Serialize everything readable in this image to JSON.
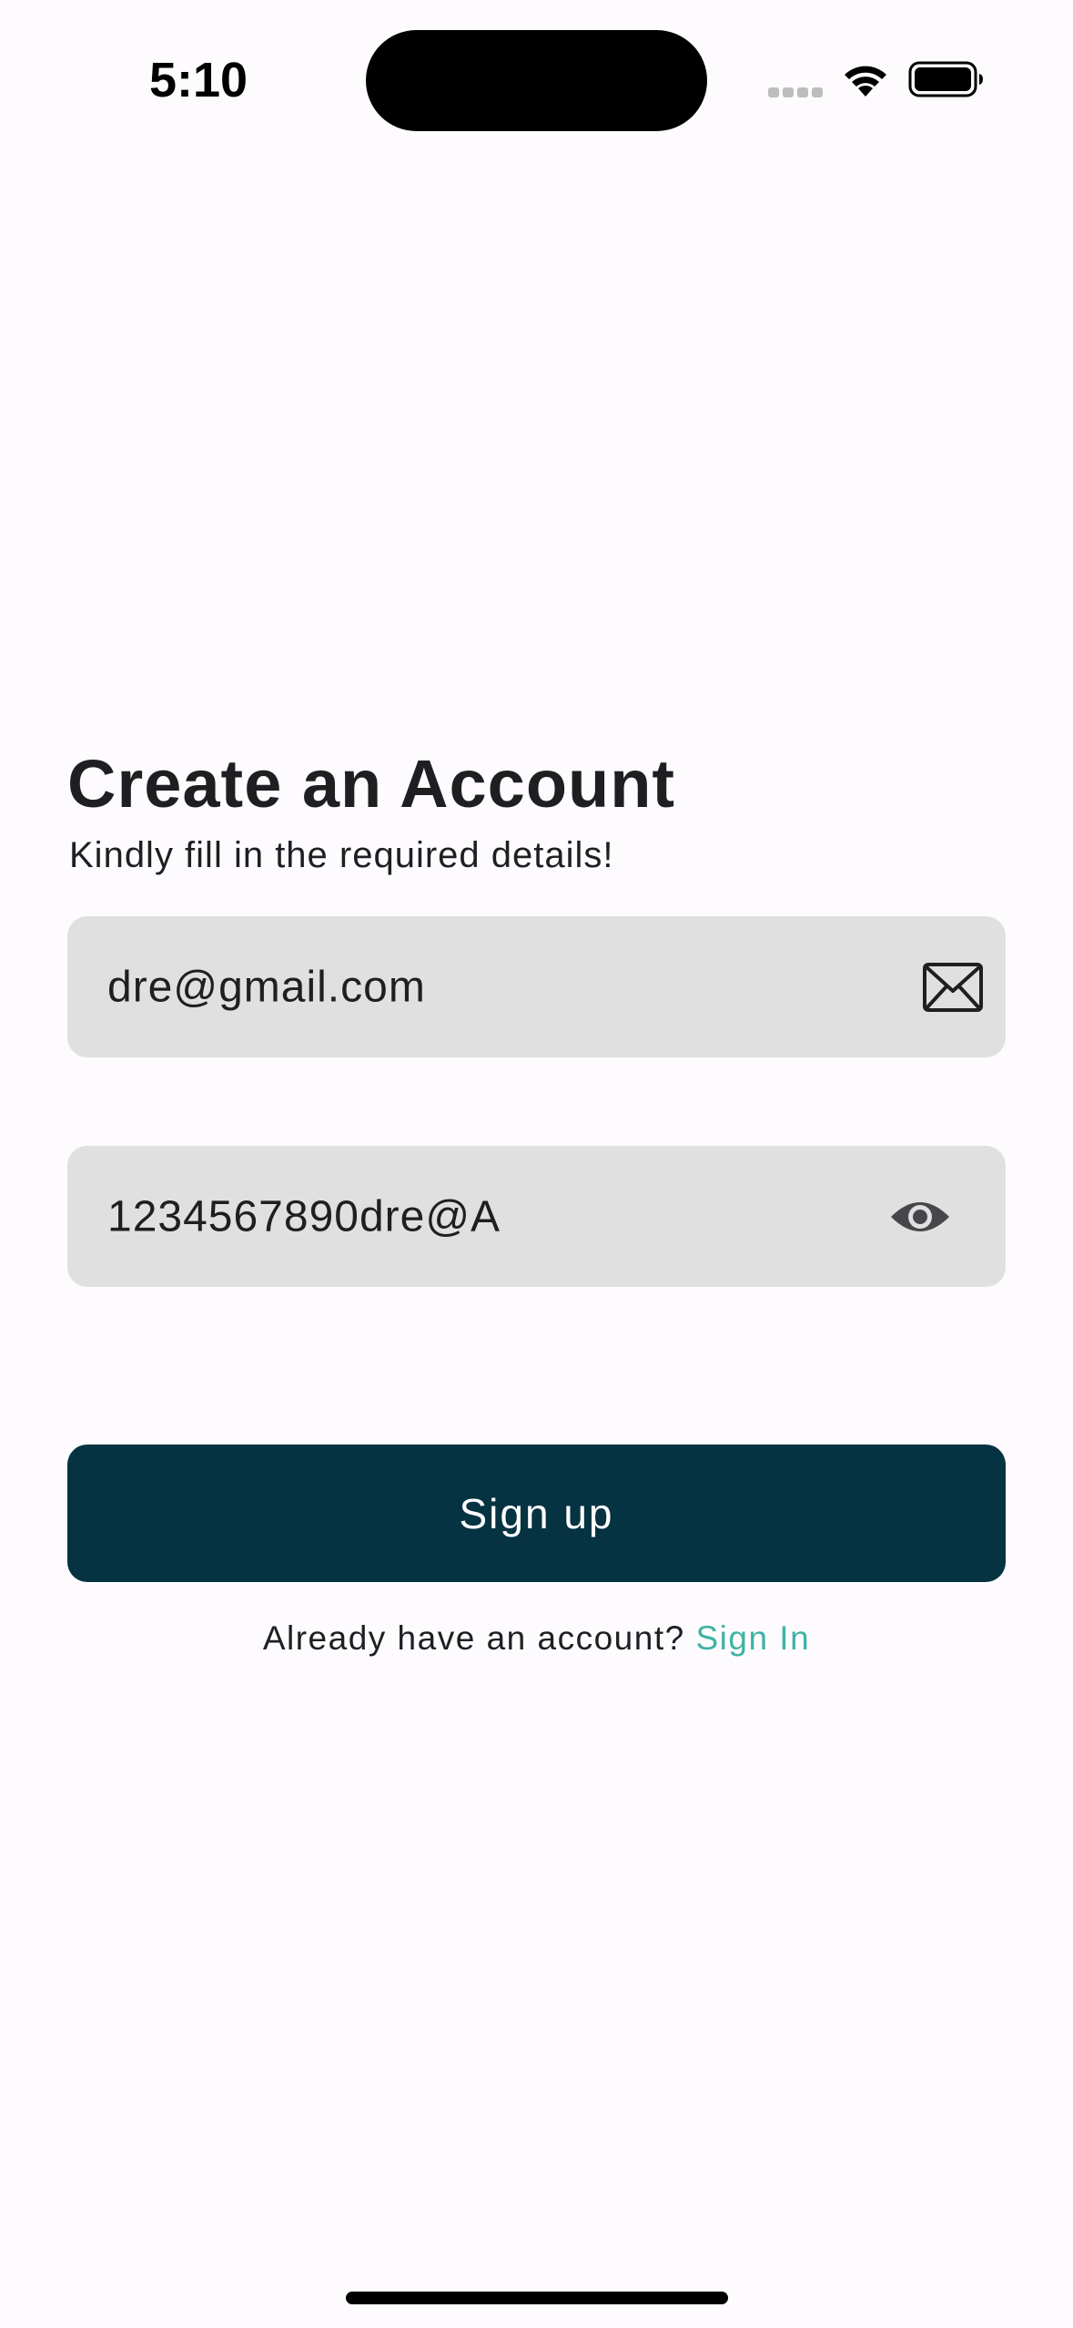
{
  "status_bar": {
    "time": "5:10"
  },
  "header": {
    "title": "Create an Account",
    "subtitle": "Kindly fill in the required details!"
  },
  "form": {
    "email": {
      "value": "dre@gmail.com",
      "icon": "mail-icon"
    },
    "password": {
      "value": "1234567890dre@A",
      "icon": "eye-icon"
    },
    "signup_label": "Sign up"
  },
  "footer": {
    "prompt": "Already have an account?",
    "link_label": "Sign In"
  },
  "colors": {
    "background": "#fefbfe",
    "field": "#e0e0e0",
    "button": "#063341",
    "link": "#3fb3a4"
  }
}
